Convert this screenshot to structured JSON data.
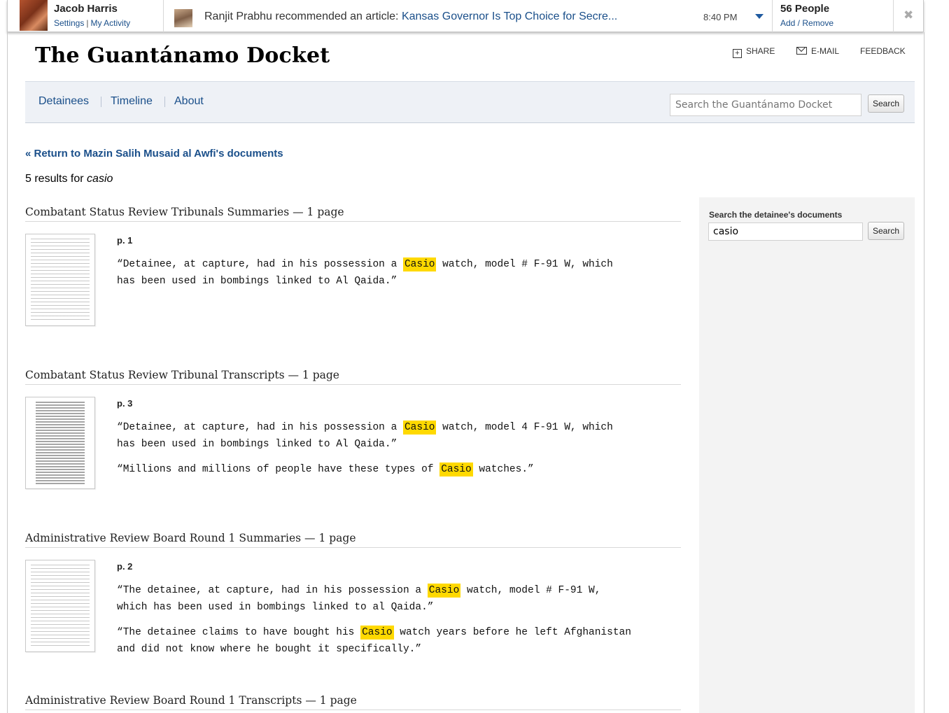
{
  "topbar": {
    "user_name": "Jacob Harris",
    "settings_link": "Settings",
    "links_sep": "|",
    "activity_link": "My Activity",
    "rec_text": "Ranjit Prabhu recommended an article:",
    "rec_article": "Kansas Governor Is Top Choice for Secre...",
    "time": "8:40 PM",
    "people_count": "56 People",
    "people_links": "Add / Remove",
    "close_glyph": "✖"
  },
  "site": {
    "title": "The Guantánamo Docket",
    "share_label": "SHARE",
    "email_label": "E-MAIL",
    "feedback_label": "FEEDBACK"
  },
  "nav": {
    "items": [
      "Detainees",
      "Timeline",
      "About"
    ],
    "search_placeholder": "Search the Guantánamo Docket",
    "search_button": "Search"
  },
  "return_link": "« Return to Mazin Salih Musaid al Awfi's documents",
  "results": {
    "count_text": "5 results for",
    "query": "casio"
  },
  "sidebar": {
    "label": "Search the detainee's documents",
    "query_value": "casio",
    "search_button": "Search"
  },
  "groups": [
    {
      "title": "Combatant Status Review Tribunals Summaries",
      "count": "— 1 page",
      "page": "p. 1",
      "snippets": [
        [
          "“Detainee, at capture, had in his possession a ",
          "Casio",
          " watch, model # F-91 W, which has been used in bombings linked to Al Qaida.”"
        ]
      ]
    },
    {
      "title": "Combatant Status Review Tribunal Transcripts",
      "count": "— 1 page",
      "page": "p. 3",
      "snippets": [
        [
          "“Detainee, at capture, had in his possession a ",
          "Casio",
          " watch, model 4 F-91 W, which has been used in bombings linked to Al Qaida.”"
        ],
        [
          "“Millions and millions of people have these types of ",
          "Casio",
          " watches.”"
        ]
      ]
    },
    {
      "title": "Administrative Review Board Round 1 Summaries",
      "count": "— 1 page",
      "page": "p. 2",
      "snippets": [
        [
          "“The detainee, at capture, had in his possession a ",
          "Casio",
          " watch, model # F-91 W, which has been used in bombings linked to al Qaida.”"
        ],
        [
          "“The detainee claims to have bought his ",
          "Casio",
          " watch years before he left Afghanistan and did not know where he bought it specifically.”"
        ]
      ]
    },
    {
      "title": "Administrative Review Board Round 1 Transcripts",
      "count": "— 1 page"
    }
  ]
}
